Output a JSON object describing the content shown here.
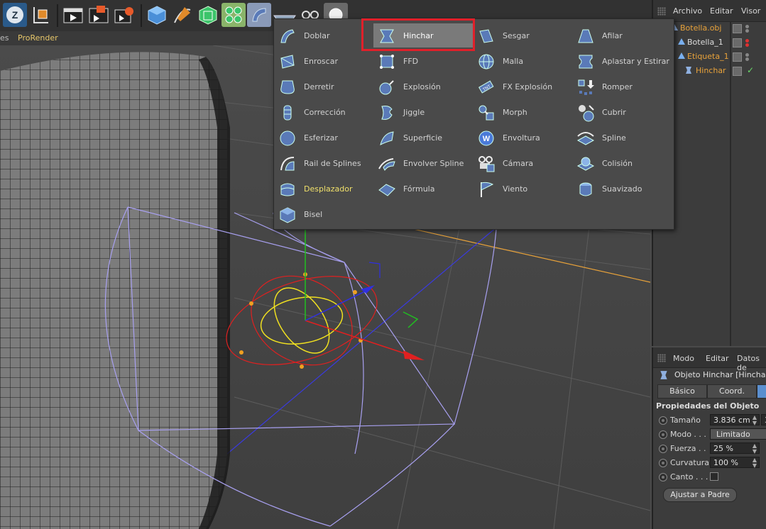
{
  "toolbar": {
    "buttons": [
      {
        "name": "undo-redo-icon"
      },
      {
        "name": "live-select-icon"
      },
      {
        "name": "cube-object-icon"
      },
      {
        "name": "render-view-icon"
      },
      {
        "name": "render-picture-viewer-icon"
      },
      {
        "name": "render-settings-icon"
      },
      {
        "name": "cube-primitive-icon"
      },
      {
        "name": "pen-spline-icon"
      },
      {
        "name": "subdivision-surface-icon"
      },
      {
        "name": "cloner-icon"
      },
      {
        "name": "deformer-bend-icon"
      },
      {
        "name": "floor-icon"
      },
      {
        "name": "camera-icon"
      },
      {
        "name": "light-icon"
      }
    ]
  },
  "viewport_menu": {
    "items": [
      "es",
      "ProRender"
    ]
  },
  "deformer_menu": {
    "columns": [
      [
        {
          "label": "Doblar",
          "icon": "bend-icon"
        },
        {
          "label": "Enroscar",
          "icon": "twist-icon"
        },
        {
          "label": "Derretir",
          "icon": "melt-icon"
        },
        {
          "label": "Corrección",
          "icon": "correction-icon"
        },
        {
          "label": "Esferizar",
          "icon": "spherify-icon"
        },
        {
          "label": "Rail de Splines",
          "icon": "spline-rail-icon"
        },
        {
          "label": "Desplazador",
          "icon": "displacer-icon",
          "highlight": "yellow"
        },
        {
          "label": "Bisel",
          "icon": "bevel-icon"
        }
      ],
      [
        {
          "label": "Hinchar",
          "icon": "bulge-icon",
          "selected": true
        },
        {
          "label": "FFD",
          "icon": "ffd-icon"
        },
        {
          "label": "Explosión",
          "icon": "explosion-icon"
        },
        {
          "label": "Jiggle",
          "icon": "jiggle-icon"
        },
        {
          "label": "Superficie",
          "icon": "surface-icon"
        },
        {
          "label": "Envolver Spline",
          "icon": "spline-wrap-icon"
        },
        {
          "label": "Fórmula",
          "icon": "formula-icon"
        }
      ],
      [
        {
          "label": "Sesgar",
          "icon": "shear-icon"
        },
        {
          "label": "Malla",
          "icon": "mesh-icon"
        },
        {
          "label": "FX Explosión",
          "icon": "explosion-fx-icon"
        },
        {
          "label": "Morph",
          "icon": "morph-icon"
        },
        {
          "label": "Envoltura",
          "icon": "wrap-icon"
        },
        {
          "label": "Cámara",
          "icon": "camera-deformer-icon"
        },
        {
          "label": "Viento",
          "icon": "wind-icon"
        }
      ],
      [
        {
          "label": "Afilar",
          "icon": "taper-icon"
        },
        {
          "label": "Aplastar y Estirar",
          "icon": "squash-stretch-icon"
        },
        {
          "label": "Romper",
          "icon": "shatter-icon"
        },
        {
          "label": "Cubrir",
          "icon": "shrink-wrap-icon"
        },
        {
          "label": "Spline",
          "icon": "spline-deformer-icon"
        },
        {
          "label": "Colisión",
          "icon": "collision-icon"
        },
        {
          "label": "Suavizado",
          "icon": "smoothing-icon"
        }
      ]
    ]
  },
  "object_manager": {
    "menu": [
      "Archivo",
      "Editar",
      "Visor"
    ],
    "objects": [
      {
        "name": "Botella.obj",
        "color": "#e8a23a",
        "icon": "null-object-icon",
        "indent": 0
      },
      {
        "name": "Botella_1",
        "color": "#dddddd",
        "icon": "polygon-object-icon",
        "indent": 1
      },
      {
        "name": "Etiqueta_1",
        "color": "#e8a23a",
        "icon": "polygon-object-icon",
        "indent": 1
      },
      {
        "name": "Hinchar",
        "color": "#e8a23a",
        "icon": "bulge-icon",
        "indent": 2
      }
    ]
  },
  "attribute_manager": {
    "menu": [
      "Modo",
      "Editar",
      "Datos de"
    ],
    "title": "Objeto Hinchar  [Hinchar]",
    "tabs": [
      "Básico",
      "Coord."
    ],
    "section": "Propiedades del Objeto",
    "fields": [
      {
        "label": "Tamaño",
        "value": "3.836 cm",
        "extra": "3"
      },
      {
        "label": "Modo . . .",
        "value": "Limitado"
      },
      {
        "label": "Fuerza . .",
        "value": "25 %"
      },
      {
        "label": "Curvatura",
        "value": "100 %"
      },
      {
        "label": "Canto . . .",
        "value": ""
      }
    ],
    "button": "Ajustar a Padre"
  },
  "colors": {
    "accent_orange": "#e8a23a",
    "selection_red": "#e0202a",
    "bulge_cage": "#a8a0f0",
    "menu_bg": "#4a4a4a",
    "menu_highlight": "#7a7a7a"
  }
}
